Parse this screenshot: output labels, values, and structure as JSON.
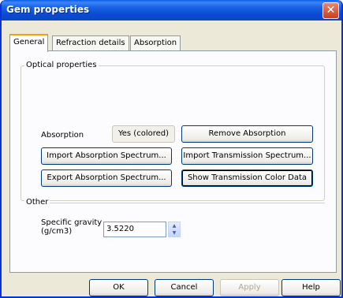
{
  "window": {
    "title": "Gem properties",
    "close_glyph": "✕"
  },
  "tabs": [
    {
      "label": "General"
    },
    {
      "label": "Refraction details"
    },
    {
      "label": "Absorption"
    }
  ],
  "optical": {
    "group_title": "Optical properties",
    "absorption_label": "Absorption",
    "absorption_value": "Yes (colored)",
    "remove_absorption": "Remove Absorption",
    "import_absorption": "Import Absorption Spectrum...",
    "import_transmission": "Import Transmission Spectrum...",
    "export_absorption": "Export Absorption Spectrum...",
    "show_transmission": "Show Transmission Color Data"
  },
  "other": {
    "group_title": "Other",
    "sg_label_line1": "Specific gravity",
    "sg_label_line2": "(g/cm3)",
    "sg_value": "3.5220",
    "spin_up": "▲",
    "spin_down": "▼"
  },
  "footer": {
    "ok": "OK",
    "cancel": "Cancel",
    "apply": "Apply",
    "help": "Help"
  },
  "colors": {
    "titlebar": "#0a4ad2",
    "face": "#ece9d8",
    "close": "#c4401e"
  }
}
